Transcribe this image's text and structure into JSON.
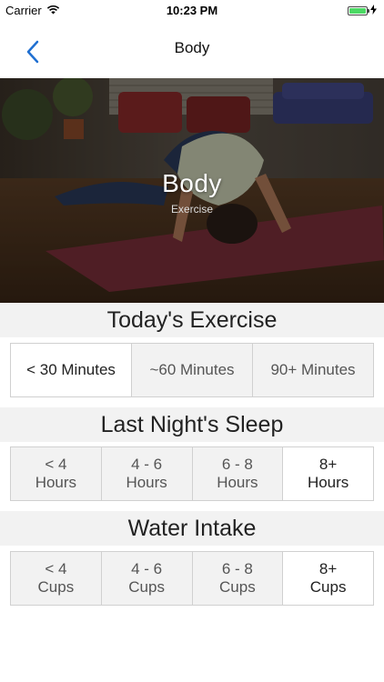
{
  "status_bar": {
    "carrier": "Carrier",
    "time": "10:23 PM",
    "battery_level": 1.0
  },
  "nav": {
    "title": "Body",
    "back_icon": "chevron-left-icon",
    "accent_color": "#1f6fd1"
  },
  "hero": {
    "title": "Body",
    "subtitle": "Exercise"
  },
  "sections": [
    {
      "title": "Today's Exercise",
      "options": [
        {
          "label": "< 30 Minutes",
          "selected": true
        },
        {
          "label": "~60 Minutes",
          "selected": false
        },
        {
          "label": "90+ Minutes",
          "selected": false
        }
      ]
    },
    {
      "title": "Last Night's Sleep",
      "options": [
        {
          "label": "< 4\nHours",
          "selected": false
        },
        {
          "label": "4 - 6\nHours",
          "selected": false
        },
        {
          "label": "6 - 8\nHours",
          "selected": false
        },
        {
          "label": "8+\nHours",
          "selected": true
        }
      ]
    },
    {
      "title": "Water Intake",
      "options": [
        {
          "label": "< 4\nCups",
          "selected": false
        },
        {
          "label": "4 - 6\nCups",
          "selected": false
        },
        {
          "label": "6 - 8\nCups",
          "selected": false
        },
        {
          "label": "8+\nCups",
          "selected": true
        }
      ]
    }
  ]
}
